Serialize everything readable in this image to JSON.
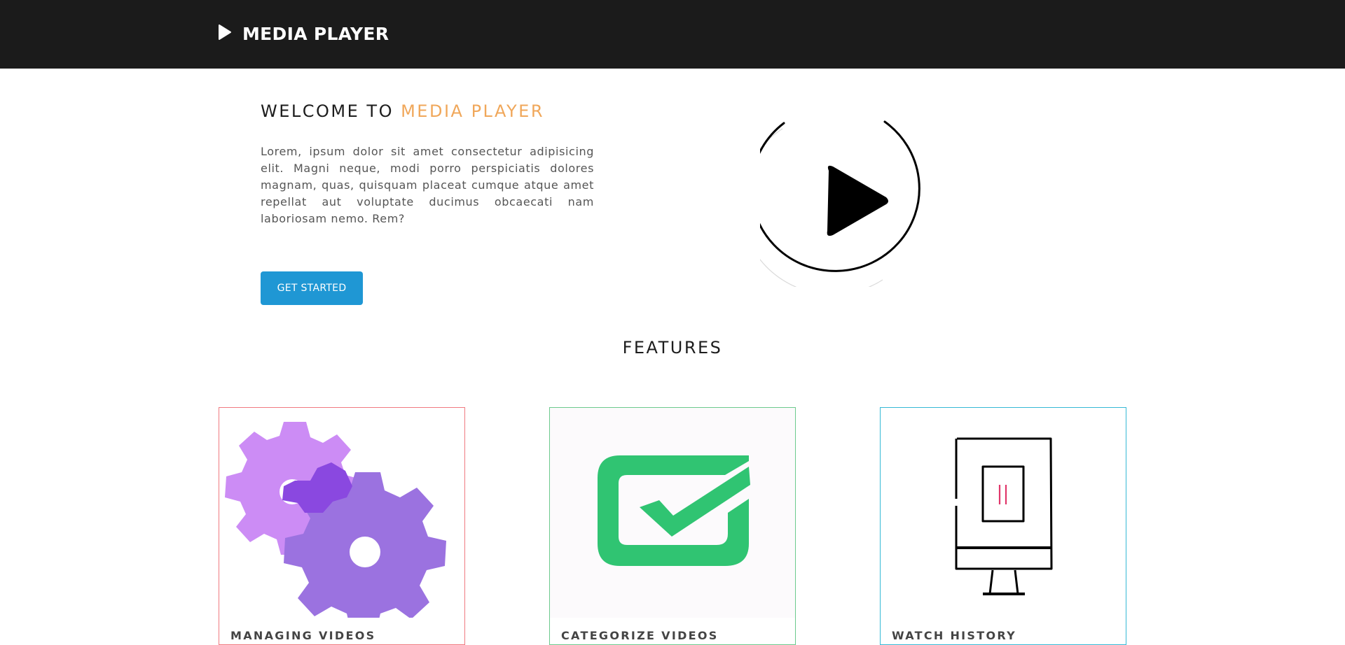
{
  "header": {
    "brand_name": "MEDIA PLAYER",
    "brand_icon": "play-icon",
    "background": "#1b1b1b"
  },
  "hero": {
    "title_prefix": "WELCOME TO ",
    "title_accent": "MEDIA PLAYER",
    "accent_color": "#f0a75a",
    "description": "Lorem, ipsum dolor sit amet consectetur adipisicing elit. Magni neque, modi porro perspiciatis dolores magnam, quas, quisquam placeat cumque atque amet repellat aut voluptate ducimus obcaecati nam laboriosam nemo. Rem?",
    "cta_label": "GET STARTED",
    "cta_color": "#1f97d4",
    "graphic_icon": "play-circle-icon"
  },
  "features": {
    "title": "FEATURES",
    "cards": [
      {
        "title": "MANAGING VIDEOS",
        "icon": "gears-icon",
        "border_color": "#f07a80"
      },
      {
        "title": "CATEGORIZE VIDEOS",
        "icon": "checkmark-icon",
        "border_color": "#6cca8d"
      },
      {
        "title": "WATCH HISTORY",
        "icon": "monitor-icon",
        "border_color": "#36b9d6"
      }
    ]
  }
}
